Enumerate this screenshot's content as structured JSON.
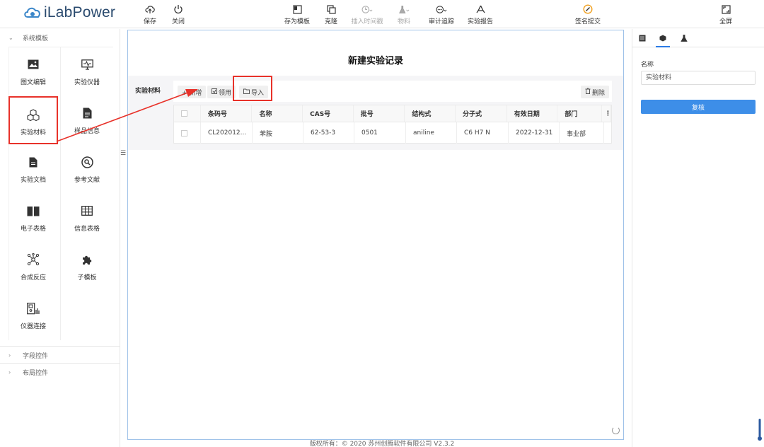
{
  "app": {
    "logo_text": "iLabPower"
  },
  "toolbar": {
    "save": "保存",
    "close": "关闭",
    "save_template": "存为模板",
    "clone": "克隆",
    "insert_timestamp": "插入时间戳",
    "materials": "物料",
    "audit_trail": "审计追踪",
    "report": "实验报告",
    "sign_submit": "签名提交",
    "fullscreen": "全屏"
  },
  "left_panel": {
    "system_templates": "系统模板",
    "tiles": [
      {
        "label": "图文编辑",
        "icon": "image-icon"
      },
      {
        "label": "实验仪器",
        "icon": "monitor-icon"
      },
      {
        "label": "实验材料",
        "icon": "cubes-icon"
      },
      {
        "label": "样品信息",
        "icon": "file-icon"
      },
      {
        "label": "实验文档",
        "icon": "document-icon"
      },
      {
        "label": "参考文献",
        "icon": "search-circle-icon"
      },
      {
        "label": "电子表格",
        "icon": "book-icon"
      },
      {
        "label": "信息表格",
        "icon": "table-icon"
      },
      {
        "label": "合成反应",
        "icon": "molecule-icon"
      },
      {
        "label": "子模板",
        "icon": "puzzle-icon"
      },
      {
        "label": "仪器连接",
        "icon": "instrument-link-icon"
      }
    ],
    "field_controls": "字段控件",
    "layout_controls": "布局控件"
  },
  "document": {
    "title": "新建实验记录",
    "material_label": "实验材料",
    "buttons": {
      "add": "+ 新增",
      "use": "领用",
      "import": "导入",
      "delete": "删除"
    },
    "table": {
      "headers": [
        "条码号",
        "名称",
        "CAS号",
        "批号",
        "结构式",
        "分子式",
        "有效日期",
        "部门"
      ],
      "rows": [
        [
          "CL202012...",
          "苯胺",
          "62-53-3",
          "0501",
          "aniline",
          "C6 H7 N",
          "2022-12-31",
          "事业部"
        ]
      ]
    }
  },
  "right_panel": {
    "name_label": "名称",
    "name_value": "实验材料",
    "review_button": "复核"
  },
  "footer": {
    "text": "版权所有：© 2020 苏州创腾软件有限公司   V2.3.2"
  },
  "colors": {
    "highlight": "#e8322a",
    "primary": "#3d8ee8",
    "canvas_border": "#9ec1e8"
  }
}
